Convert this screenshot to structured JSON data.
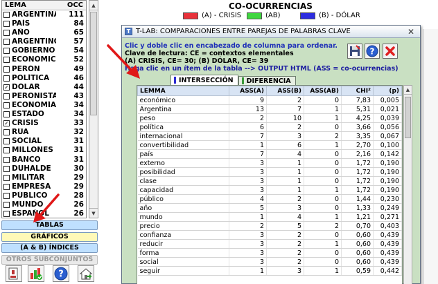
{
  "left_panel": {
    "header": {
      "lemma": "LEMA",
      "occ": "OCC"
    },
    "items": [
      {
        "label": "ARGENTINA",
        "occ": "111",
        "checked": false
      },
      {
        "label": "PAÍS",
        "occ": "84",
        "checked": false
      },
      {
        "label": "AÑO",
        "occ": "65",
        "checked": false
      },
      {
        "label": "ARGENTINO",
        "occ": "57",
        "checked": false
      },
      {
        "label": "GOBIERNO",
        "occ": "54",
        "checked": false
      },
      {
        "label": "ECONÓMICO",
        "occ": "52",
        "checked": false
      },
      {
        "label": "PERÓN",
        "occ": "49",
        "checked": false
      },
      {
        "label": "POLÍTICA",
        "occ": "46",
        "checked": false
      },
      {
        "label": "DÓLAR",
        "occ": "44",
        "checked": true
      },
      {
        "label": "PERONISTA",
        "occ": "43",
        "checked": false
      },
      {
        "label": "ECONOMÍA",
        "occ": "34",
        "checked": false
      },
      {
        "label": "ESTADO",
        "occ": "34",
        "checked": false
      },
      {
        "label": "CRISIS",
        "occ": "33",
        "checked": true
      },
      {
        "label": "RÚA",
        "occ": "32",
        "checked": false
      },
      {
        "label": "SOCIAL",
        "occ": "31",
        "checked": false
      },
      {
        "label": "MILLONES",
        "occ": "31",
        "checked": false
      },
      {
        "label": "BANCO",
        "occ": "31",
        "checked": false
      },
      {
        "label": "DUHALDE",
        "occ": "30",
        "checked": false
      },
      {
        "label": "MILITAR",
        "occ": "29",
        "checked": false
      },
      {
        "label": "EMPRESA",
        "occ": "29",
        "checked": false
      },
      {
        "label": "PÚBLICO",
        "occ": "28",
        "checked": false
      },
      {
        "label": "MUNDO",
        "occ": "26",
        "checked": false
      },
      {
        "label": "ESPAÑOL",
        "occ": "26",
        "checked": false
      }
    ],
    "buttons": {
      "tablas": "TABLAS",
      "graficos": "GRÁFICOS",
      "indices": "(A & B)  ÍNDICES",
      "otros": "OTROS SUBCONJUNTOS"
    }
  },
  "chart": {
    "title": "CO-OCURRENCIAS",
    "legend": [
      {
        "label": "(A) - CRISIS",
        "color": "#e8323a"
      },
      {
        "label": "(AB)",
        "color": "#3fd63f"
      },
      {
        "label": "(B) - DÓLAR",
        "color": "#2d2de0"
      }
    ]
  },
  "dialog": {
    "title": "T-LAB: COMPARACIONES ENTRE PAREJAS DE PALABRAS CLAVE",
    "close_glyph": "✕",
    "instructions": {
      "line1": "Clic y doble clic en encabezado de columna para ordenar.",
      "line2": "Clave de lectura: CE = contextos elementales",
      "line3": "(A) CRISIS, CE= 30; (B) DÓLAR, CE= 39",
      "line4": "Haga clic en un ítem de la tabla --> OUTPUT HTML (ASS = co-ocurrencias)"
    },
    "tabs": [
      "INTERSECCIÓN",
      "DIFERENCIA"
    ],
    "columns": [
      "LEMMA",
      "ASS(A)",
      "ASS(B)",
      "ASS(AB)",
      "CHI²",
      "(p)"
    ],
    "rows": [
      [
        "económico",
        "9",
        "2",
        "0",
        "7,83",
        "0,005"
      ],
      [
        "Argentina",
        "13",
        "7",
        "1",
        "5,31",
        "0,021"
      ],
      [
        "peso",
        "2",
        "10",
        "1",
        "4,25",
        "0,039"
      ],
      [
        "política",
        "6",
        "2",
        "0",
        "3,66",
        "0,056"
      ],
      [
        "internacional",
        "7",
        "3",
        "2",
        "3,35",
        "0,067"
      ],
      [
        "convertibilidad",
        "1",
        "6",
        "1",
        "2,70",
        "0,100"
      ],
      [
        "país",
        "7",
        "4",
        "0",
        "2,16",
        "0,142"
      ],
      [
        "externo",
        "3",
        "1",
        "0",
        "1,72",
        "0,190"
      ],
      [
        "posibilidad",
        "3",
        "1",
        "0",
        "1,72",
        "0,190"
      ],
      [
        "clase",
        "3",
        "1",
        "0",
        "1,72",
        "0,190"
      ],
      [
        "capacidad",
        "3",
        "1",
        "1",
        "1,72",
        "0,190"
      ],
      [
        "público",
        "4",
        "2",
        "0",
        "1,44",
        "0,230"
      ],
      [
        "año",
        "5",
        "3",
        "0",
        "1,33",
        "0,249"
      ],
      [
        "mundo",
        "1",
        "4",
        "1",
        "1,21",
        "0,271"
      ],
      [
        "precio",
        "2",
        "5",
        "2",
        "0,70",
        "0,403"
      ],
      [
        "confianza",
        "3",
        "2",
        "0",
        "0,60",
        "0,439"
      ],
      [
        "reducir",
        "3",
        "2",
        "1",
        "0,60",
        "0,439"
      ],
      [
        "forma",
        "3",
        "2",
        "0",
        "0,60",
        "0,439"
      ],
      [
        "social",
        "3",
        "2",
        "0",
        "0,60",
        "0,439"
      ],
      [
        "seguir",
        "1",
        "3",
        "1",
        "0,59",
        "0,442"
      ]
    ]
  },
  "colors": {
    "accent_blue": "#1e2fb8",
    "arrow_red": "#e01818",
    "dialog_bg": "#c9e0c2",
    "table_header": "#d8e4f4"
  }
}
